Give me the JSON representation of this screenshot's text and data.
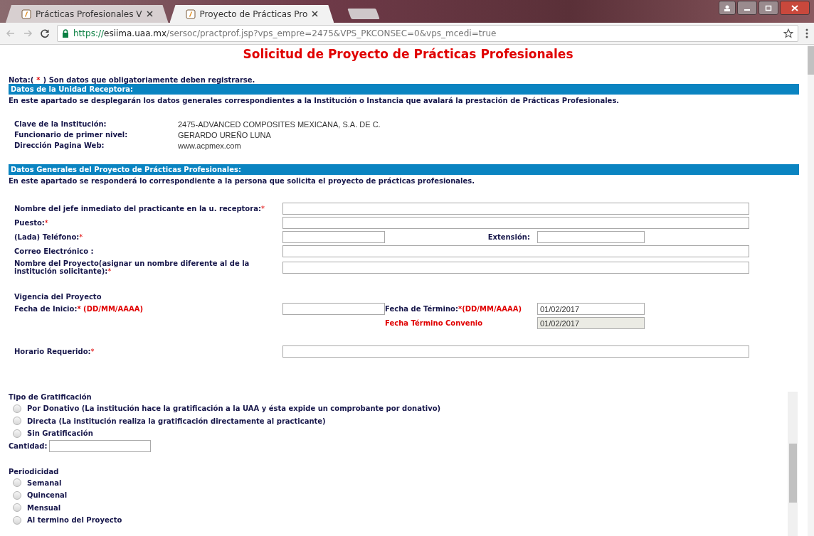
{
  "browser": {
    "tabs": [
      {
        "title": "Prácticas Profesionales V",
        "selected": false
      },
      {
        "title": "Proyecto de Prácticas Pro",
        "selected": true
      }
    ],
    "url": {
      "scheme": "https://",
      "host": "esiima.uaa.mx",
      "path": "/sersoc/practprof.jsp?vps_empre=2475&VPS_PKCONSEC=0&vps_mcedi=true"
    }
  },
  "title": "Solicitud de Proyecto de Prácticas Profesionales",
  "note": {
    "before": "Nota:(",
    "mark": "*",
    "after": ") Son datos que obligatoriamente deben registrarse."
  },
  "receptora": {
    "heading": "Datos de la Unidad Receptora:",
    "description": "En este apartado se desplegarán los datos generales correspondientes a la Institución o Instancia que avalará la prestación de Prácticas Profesionales.",
    "rows": [
      {
        "label": "Clave de la Institución:",
        "value": "2475-ADVANCED COMPOSITES MEXICANA, S.A. DE C."
      },
      {
        "label": "Funcionario de primer nivel:",
        "value": "GERARDO UREÑO LUNA"
      },
      {
        "label": "Dirección Pagina Web:",
        "value": "www.acpmex.com"
      }
    ]
  },
  "proyecto": {
    "heading": "Datos Generales del Proyecto de Prácticas Profesionales:",
    "description": "En este apartado se responderá lo correspondiente a la persona que solicita el proyecto de prácticas profesionales.",
    "fields": [
      {
        "kind": "wide",
        "label": "Nombre del jefe inmediato del practicante en la u. receptora:",
        "mark": "*"
      },
      {
        "kind": "wide",
        "label": "Puesto:",
        "mark": "*"
      },
      {
        "kind": "split",
        "label": "(Lada) Teléfono:",
        "mark": "*",
        "second_label": "Extensión:"
      },
      {
        "kind": "wide",
        "label": "Correo Electrónico :"
      },
      {
        "kind": "wide",
        "label": "Nombre del Proyecto(asignar un nombre diferente al de la institución solicitante):",
        "mark": "*"
      }
    ],
    "vigencia": {
      "heading": "Vigencia del Proyecto",
      "start_label": "Fecha de Inicio:",
      "start_hint": "* (DD/MM/AAAA)",
      "end_label": "Fecha de Término:",
      "end_hint": "*(DD/MM/AAAA)",
      "end_value": "01/02/2017",
      "convenio_label": "Fecha Término Convenio",
      "convenio_value": "01/02/2017",
      "convenio_disabled": true
    },
    "horario": {
      "label": "Horario Requerido:",
      "mark": "*"
    }
  },
  "gratificacion": {
    "heading": "Tipo de Gratificación",
    "options": [
      {
        "label": "Por Donativo (La institución hace la gratificación a la UAA y ésta expide un comprobante por donativo)",
        "selected": false
      },
      {
        "label": "Directa (La institución realiza la gratificación directamente al practicante)",
        "selected": false
      },
      {
        "label": "Sin Gratificación",
        "selected": false
      }
    ],
    "amount_label": "Cantidad:"
  },
  "periodicidad": {
    "heading": "Periodicidad",
    "options": [
      {
        "label": "Semanal",
        "selected": false
      },
      {
        "label": "Quincenal",
        "selected": false
      },
      {
        "label": "Mensual",
        "selected": false
      },
      {
        "label": "Al termino del Proyecto",
        "selected": false
      }
    ]
  }
}
